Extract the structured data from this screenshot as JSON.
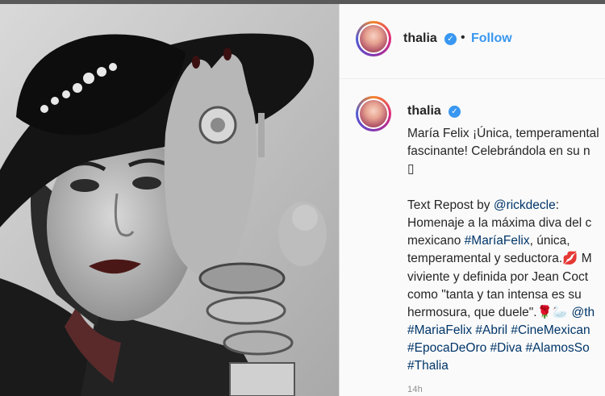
{
  "post_header": {
    "username": "thalia",
    "separator": "•",
    "follow_label": "Follow"
  },
  "caption": {
    "username": "thalia",
    "lines": [
      {
        "segments": [
          {
            "text": "María Felix ¡Única, temperamental"
          }
        ]
      },
      {
        "segments": [
          {
            "text": "fascinante! Celebrándola en su n"
          }
        ]
      },
      {
        "segments": [
          {
            "text": "▯"
          }
        ]
      },
      {
        "segments": [
          {
            "text": ""
          }
        ]
      },
      {
        "segments": [
          {
            "text": "Text Repost by "
          },
          {
            "text": "@rickdecle",
            "link": true
          },
          {
            "text": ":"
          }
        ]
      },
      {
        "segments": [
          {
            "text": "Homenaje a la máxima diva del c"
          }
        ]
      },
      {
        "segments": [
          {
            "text": "mexicano "
          },
          {
            "text": "#MaríaFelix",
            "link": true
          },
          {
            "text": ", única,"
          }
        ]
      },
      {
        "segments": [
          {
            "text": "temperamental y seductora.💋 M"
          }
        ]
      },
      {
        "segments": [
          {
            "text": "viviente y definida por Jean Coct"
          }
        ]
      },
      {
        "segments": [
          {
            "text": "como \"tanta y tan intensa es su"
          }
        ]
      },
      {
        "segments": [
          {
            "text": "hermosura, que duele\".🌹🦢 "
          },
          {
            "text": "@th",
            "link": true
          }
        ]
      },
      {
        "segments": [
          {
            "text": "#MariaFelix #Abril #CineMexican",
            "link": true
          }
        ]
      },
      {
        "segments": [
          {
            "text": "#EpocaDeOro #Diva #AlamosSo",
            "link": true
          }
        ]
      },
      {
        "segments": [
          {
            "text": "#Thalia",
            "link": true
          }
        ]
      }
    ]
  },
  "timestamp": "14h",
  "colors": {
    "link": "#003569",
    "follow": "#3897f0",
    "verified": "#3897f0",
    "text": "#262626"
  },
  "icons": {
    "verified": "verified-badge-icon"
  }
}
